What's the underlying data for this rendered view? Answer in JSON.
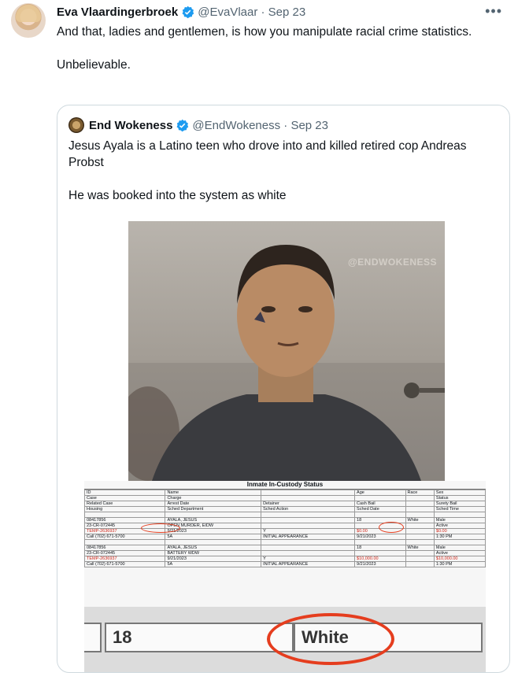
{
  "tweet": {
    "author_name": "Eva Vlaardingerbroek",
    "handle": "@EvaVlaar",
    "date": "Sep 23",
    "text": "And that, ladies and gentlemen, is how you manipulate racial crime statistics.\n\nUnbelievable."
  },
  "quote": {
    "author_name": "End Wokeness",
    "handle": "@EndWokeness",
    "date": "Sep 23",
    "text": "Jesus Ayala is a Latino teen who drove into and killed retired cop Andreas Probst\n\nHe was booked into the system as white",
    "watermark": "@ENDWOKENESS",
    "doc_title": "Inmate In-Custody Status",
    "zoom_age": "18",
    "zoom_race": "White"
  },
  "doc_rows": [
    [
      "ID",
      "Name",
      "",
      "Age",
      "Race",
      "Sex"
    ],
    [
      "Case",
      "Charge",
      "",
      "",
      "",
      "Status"
    ],
    [
      "Related Case",
      "Arrest Date",
      "Detainer",
      "Cash Bail",
      "",
      "Surety Bail"
    ],
    [
      "Housing",
      "Sched Department",
      "Sched Action",
      "Sched Date",
      "",
      "Sched Time"
    ],
    [
      "",
      "",
      "",
      "",
      "",
      ""
    ],
    [
      "08417856",
      "AYALA, JESUS",
      "",
      "18",
      "White",
      "Male"
    ],
    [
      "23-CR-072445",
      "OPEN MURDER, EIDW",
      "",
      "",
      "",
      "Active"
    ],
    [
      "TEMP-2636937",
      "9/21/2023",
      "Y",
      "$0.00",
      "",
      "$0.00"
    ],
    [
      "Call (702) 671-5700",
      "5A",
      "INITIAL APPEARANCE",
      "9/21/2023",
      "",
      "1:30 PM"
    ],
    [
      "",
      "",
      "",
      "",
      "",
      ""
    ],
    [
      "08417856",
      "AYALA, JESUS",
      "",
      "18",
      "White",
      "Male"
    ],
    [
      "23-CR-072445",
      "BATTERY WDW",
      "",
      "",
      "",
      "Active"
    ],
    [
      "TEMP-2636937",
      "9/21/2023",
      "Y",
      "$10,000.00",
      "",
      "$10,000.00"
    ],
    [
      "Call (702) 671-5700",
      "5A",
      "INITIAL APPEARANCE",
      "9/21/2023",
      "",
      "1:30 PM"
    ]
  ],
  "colors": {
    "verified": "#1d9bf0",
    "link_grey": "#536471",
    "annotation": "#e53d1e"
  },
  "icons": {
    "verified": "verified-badge-icon",
    "more": "more-icon"
  }
}
